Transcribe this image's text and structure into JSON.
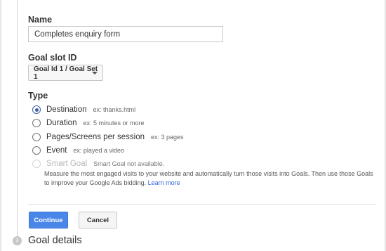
{
  "form": {
    "name_label": "Name",
    "name_value": "Completes enquiry form",
    "slot_label": "Goal slot ID",
    "slot_value": "Goal Id 1 / Goal Set 1",
    "type_label": "Type",
    "options": [
      {
        "label": "Destination",
        "hint": "ex: thanks.html",
        "selected": true,
        "disabled": false
      },
      {
        "label": "Duration",
        "hint": "ex: 5 minutes or more",
        "selected": false,
        "disabled": false
      },
      {
        "label": "Pages/Screens per session",
        "hint": "ex: 3 pages",
        "selected": false,
        "disabled": false
      },
      {
        "label": "Event",
        "hint": "ex: played a video",
        "selected": false,
        "disabled": false
      },
      {
        "label": "Smart Goal",
        "hint": "Smart Goal not available.",
        "selected": false,
        "disabled": true
      }
    ],
    "smart_goal_description": "Measure the most engaged visits to your website and automatically turn those visits into Goals. Then use those Goals to improve your Google Ads bidding.",
    "learn_more": "Learn more"
  },
  "actions": {
    "continue_label": "Continue",
    "cancel_label": "Cancel"
  },
  "next_step": {
    "number": "3",
    "title": "Goal details"
  }
}
